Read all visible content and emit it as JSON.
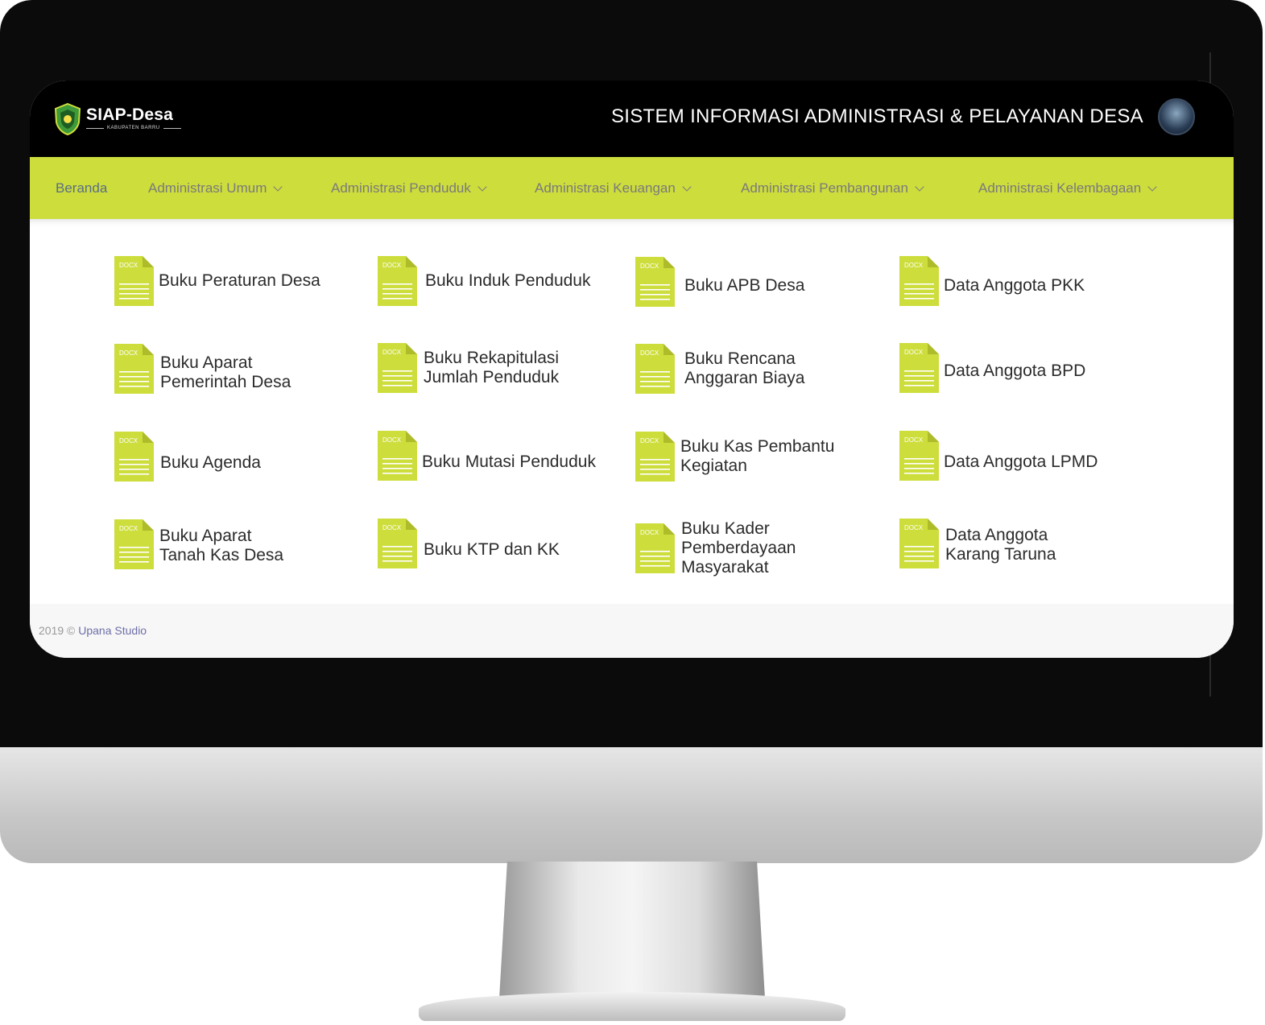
{
  "brand": {
    "name": "SIAP-Desa",
    "subtitle": "KABUPATEN BARRU"
  },
  "header": {
    "title": "SISTEM INFORMASI ADMINISTRASI & PELAYANAN DESA"
  },
  "nav": {
    "items": [
      {
        "label": "Beranda",
        "active": true
      },
      {
        "label": "Administrasi Umum",
        "dropdown": true
      },
      {
        "label": "Administrasi Penduduk",
        "dropdown": true
      },
      {
        "label": "Administrasi Keuangan",
        "dropdown": true
      },
      {
        "label": "Administrasi Pembangunan",
        "dropdown": true
      },
      {
        "label": "Administrasi Kelembagaan",
        "dropdown": true
      }
    ]
  },
  "documents": [
    {
      "icon_text": "DOCX",
      "label": "Buku Peraturan Desa"
    },
    {
      "icon_text": "DOCX",
      "label": "Buku Induk Penduduk"
    },
    {
      "icon_text": "DOCX",
      "label": "Buku APB Desa"
    },
    {
      "icon_text": "DOCX",
      "label": "Data Anggota PKK"
    },
    {
      "icon_text": "DOCX",
      "label": "Buku Aparat\nPemerintah Desa"
    },
    {
      "icon_text": "DOCX",
      "label": "Buku Rekapitulasi\nJumlah Penduduk"
    },
    {
      "icon_text": "DOCX",
      "label": "Buku Rencana\nAnggaran Biaya"
    },
    {
      "icon_text": "DOCX",
      "label": "Data Anggota BPD"
    },
    {
      "icon_text": "DOCX",
      "label": "Buku Agenda"
    },
    {
      "icon_text": "DOCX",
      "label": "Buku Mutasi Penduduk"
    },
    {
      "icon_text": "DOCX",
      "label": "Buku Kas Pembantu\nKegiatan"
    },
    {
      "icon_text": "DOCX",
      "label": "Data Anggota LPMD"
    },
    {
      "icon_text": "DOCX",
      "label": "Buku Aparat\nTanah Kas Desa"
    },
    {
      "icon_text": "DOCX",
      "label": "Buku KTP dan KK"
    },
    {
      "icon_text": "DOCX",
      "label": "Buku Kader\nPemberdayaan\nMasyarakat"
    },
    {
      "icon_text": "DOCX",
      "label": "Data Anggota\nKarang Taruna"
    }
  ],
  "footer": {
    "copyright": "2019 © ",
    "studio": "Upana Studio"
  },
  "colors": {
    "accent": "#cddd3c",
    "doc_icon": "#cddd3c",
    "topbar": "#000000",
    "footer_link": "#6e6fa8"
  }
}
